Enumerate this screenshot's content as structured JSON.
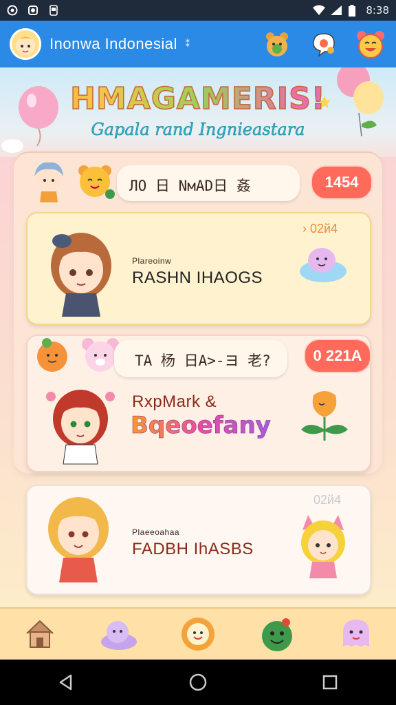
{
  "status_bar": {
    "time": "8:38"
  },
  "app_bar": {
    "title": "Inonwa Indonesial",
    "menu": "⁑"
  },
  "hero": {
    "title": "HMAGAMERIS!",
    "subtitle": "Gapala rand Ingnieastara"
  },
  "header_row": {
    "label": "ЛО 日 NмAD日 姦",
    "badge": "1454"
  },
  "cards": [
    {
      "score": "› 02й4",
      "caption": "Plareoinw",
      "title": "RASНN IHAOGS"
    },
    {
      "prompt": "ТА 杨 日А>-ヨ 老?",
      "badge": "0 221A",
      "title": "RxpMark &",
      "highlight": "Bqeoefany"
    },
    {
      "score": "02й4",
      "caption": "Plaeeoahaa",
      "title": "FADBH IhASBS"
    }
  ],
  "bottom_tabs": [
    "home-icon",
    "slime-icon",
    "face-coin-icon",
    "frog-icon",
    "ghost-icon"
  ],
  "colors": {
    "app_bar": "#2a8ae6",
    "badge": "#ff6a5b",
    "card_yellow": "#fff2cf",
    "tab_bar": "#ffe1a8"
  }
}
